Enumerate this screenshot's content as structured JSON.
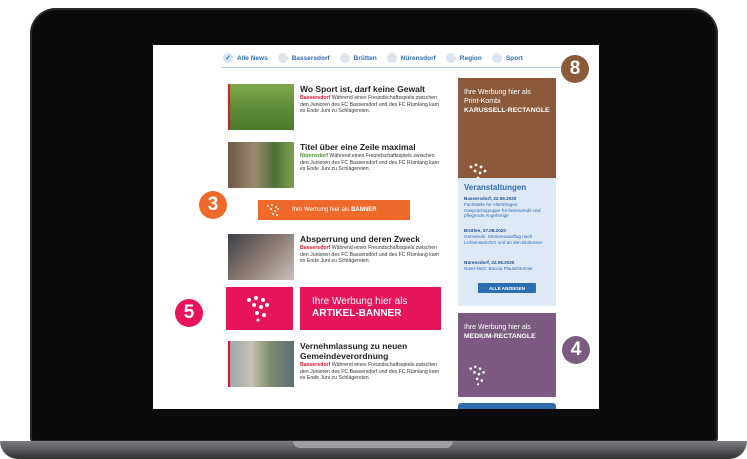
{
  "nav": {
    "items": [
      {
        "label": "Alle News",
        "checked": true
      },
      {
        "label": "Bassersdorf",
        "checked": false
      },
      {
        "label": "Brütten",
        "checked": false
      },
      {
        "label": "Nürensdorf",
        "checked": false
      },
      {
        "label": "Region",
        "checked": false
      },
      {
        "label": "Sport",
        "checked": false
      }
    ]
  },
  "articles": [
    {
      "title": "Wo Sport ist, darf keine Gewalt",
      "location": "Bassersdorf",
      "body": "Während eines Freundschaftsspiels zwischen den Junioren des FC Bassersdorf und des FC Rümlang kam es Ende Juni zu Schlägereien."
    },
    {
      "title": "Titel über eine Zeile maximal",
      "location": "Nürensdorf",
      "body": "Während eines Freundschaftsspiels zwischen den Junioren des FC Bassersdorf und des FC Rümlang kam es Ende Juni zu Schlägereien."
    },
    {
      "title": "Absperrung und deren Zweck",
      "location": "Bassersdorf",
      "body": "Während eines Freundschaftsspiels zwischen den Junioren des FC Bassersdorf und des FC Rümlang kam es Ende Juni zu Schlägereien."
    },
    {
      "title": "Vernehmlassung zu neuen Gemeindeverordnung",
      "location": "Bassersdorf",
      "body": "Während eines Freundschaftsspiels zwischen den Junioren des FC Bassersdorf und des FC Rümlang kam es Ende Juni zu Schlägereien."
    }
  ],
  "banner": {
    "prefix": "Ihre Werbung hier als",
    "strong": "BANNER"
  },
  "article_banner": {
    "line1": "Ihre Werbung hier als",
    "line2": "ARTIKEL-BANNER"
  },
  "karussell": {
    "line1": "Ihre Werbung hier als",
    "line2": "Print-Kombi",
    "line3": "KARUSSELL-RECTANGLE"
  },
  "medium": {
    "line1": "Ihre Werbung hier als",
    "line2": "MEDIUM-RECTANGLE"
  },
  "events": {
    "title": "Veranstaltungen",
    "items": [
      {
        "head": "Bassersdorf, 22.09.2020",
        "text": "Fachstelle für Altersfragen: Gesprächsgruppe für betreuende und pflegende Angehörige"
      },
      {
        "head": "Brütten, 27.08.2020",
        "text": "Gemeinde: Seniorenausflug nach Lichtenstein/SG und an den Bodensee"
      },
      {
        "head": "Nürensdorf, 22.09.2020",
        "text": "Nüeri-Netz: Boccia Plauschturnier"
      }
    ],
    "button": "ALLE ANZEIGEN"
  },
  "badges": {
    "b8": "8",
    "b3": "3",
    "b5": "5",
    "b4": "4"
  },
  "colors": {
    "brown": "#8b5a3a",
    "orange": "#ef6a2a",
    "pink": "#e5145d",
    "purple": "#7c5a82",
    "blue": "#2f6db3",
    "red": "#e2152a"
  }
}
